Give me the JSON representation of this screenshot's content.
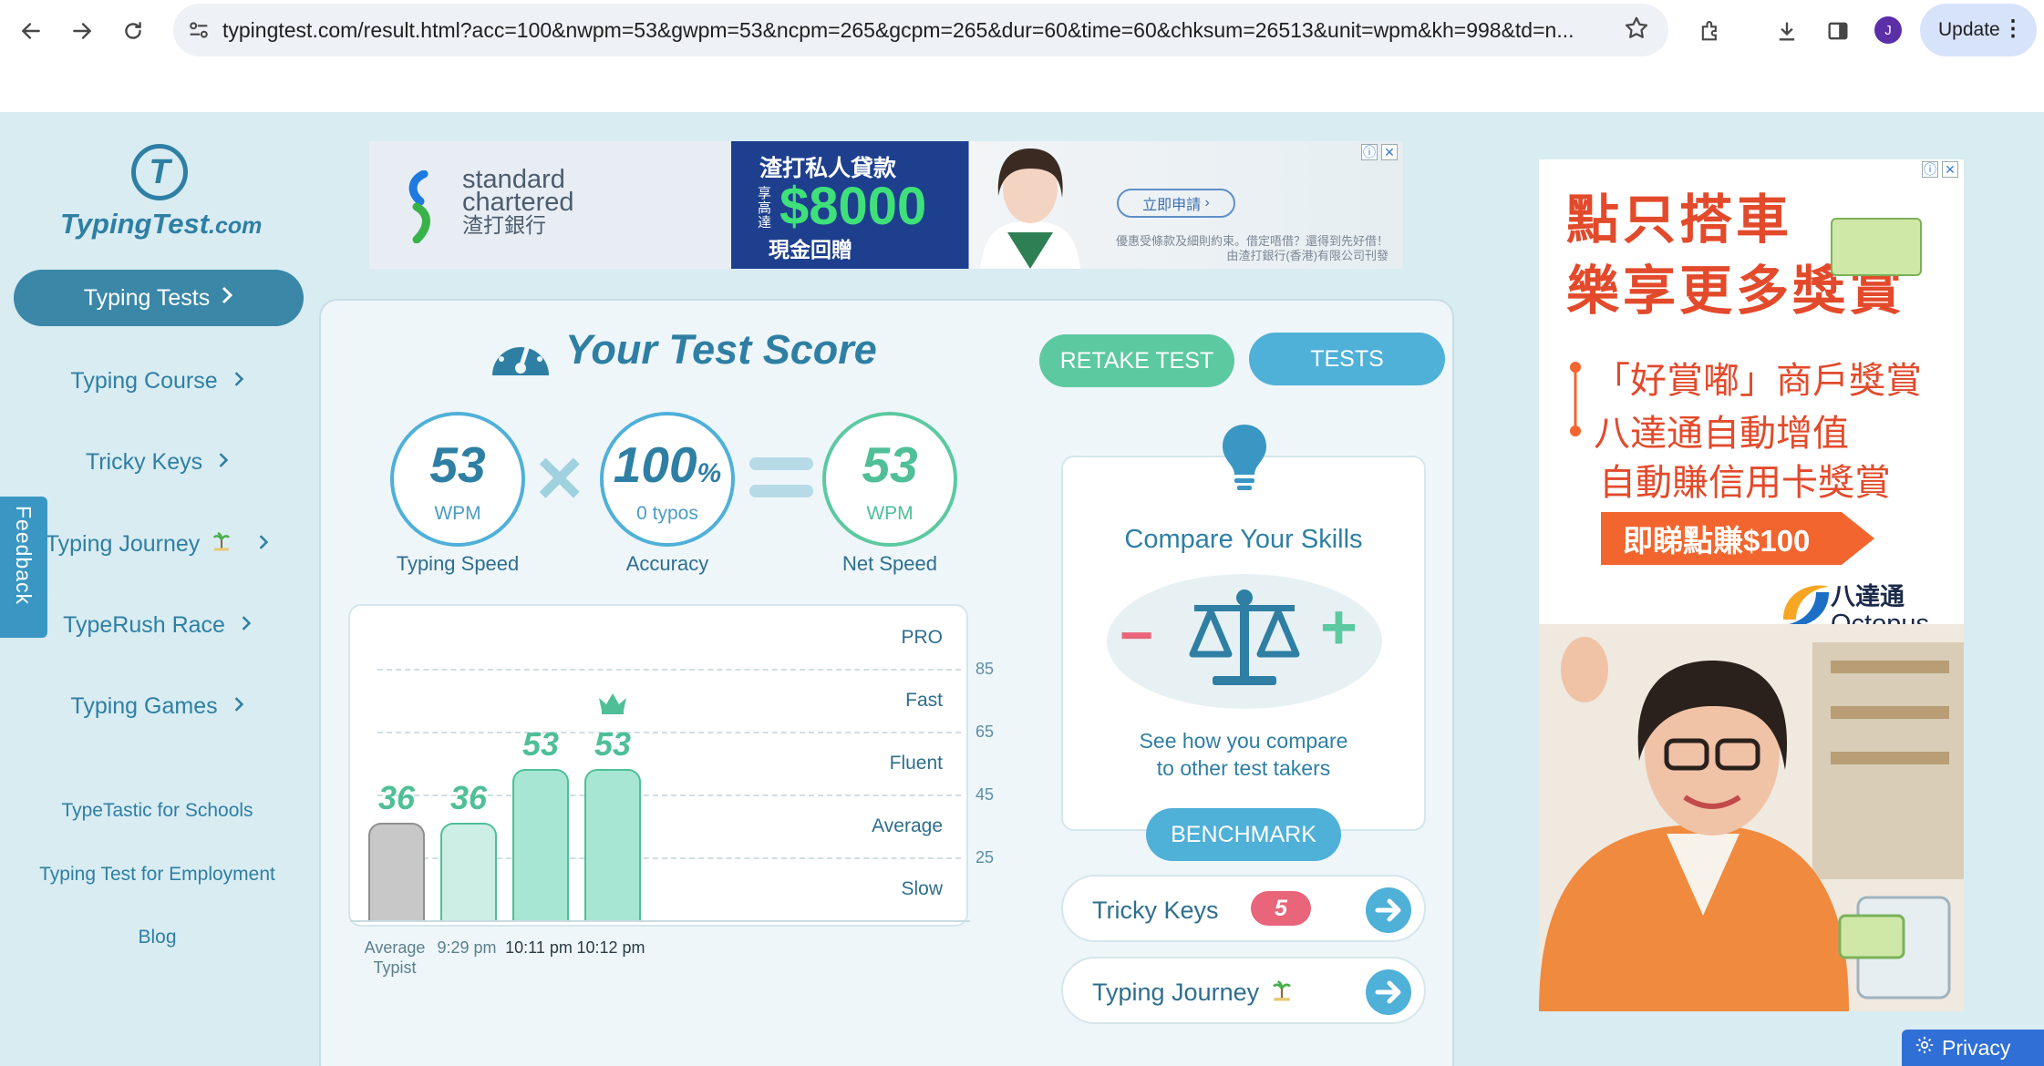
{
  "browser": {
    "url": "typingtest.com/result.html?acc=100&nwpm=53&gwpm=53&ncpm=265&gcpm=265&dur=60&time=60&chksum=26513&unit=wpm&kh=998&td=n...",
    "update_label": "Update",
    "profile_initial": "J"
  },
  "logo": {
    "mark": "T",
    "name": "TypingTest",
    "tld": ".com"
  },
  "sidebar": {
    "primary": "Typing Tests",
    "links": [
      "Typing Course",
      "Tricky Keys",
      "Typing Journey",
      "TypeRush Race",
      "Typing Games"
    ],
    "small_links": [
      "TypeTastic for Schools",
      "Typing Test for Employment",
      "Blog"
    ],
    "feedback": "Feedback"
  },
  "top_ad": {
    "brand_en_1": "standard",
    "brand_en_2": "chartered",
    "brand_zh": "渣打銀行",
    "headline": "渣打私人貸款",
    "side_text": "享高達",
    "amount": "$8000",
    "cash": "現金回贈",
    "apply": "立即申請",
    "fine_print": "優惠受條款及細則約束。借定唔借？還得到先好借！由渣打銀行(香港)有限公司刊發"
  },
  "score": {
    "title": "Your Test Score",
    "retake": "RETAKE TEST",
    "tests": "TESTS",
    "speed": {
      "value": "53",
      "unit": "WPM",
      "label": "Typing Speed"
    },
    "accuracy": {
      "value": "100",
      "pct": "%",
      "unit": "0 typos",
      "label": "Accuracy"
    },
    "net": {
      "value": "53",
      "unit": "WPM",
      "label": "Net Speed"
    },
    "times_sign": "×"
  },
  "chart_data": {
    "type": "bar",
    "categories": [
      "Average Typist",
      "9:29 pm",
      "10:11 pm",
      "10:12 pm"
    ],
    "values": [
      36,
      36,
      53,
      53
    ],
    "value_labels": [
      "36",
      "36",
      "53",
      "53"
    ],
    "ylim": [
      5,
      105
    ],
    "ticks": [
      85,
      65,
      45,
      25
    ],
    "tick_labels": [
      "85",
      "65",
      "45",
      "25"
    ],
    "tiers": [
      "PRO",
      "Fast",
      "Fluent",
      "Average",
      "Slow"
    ],
    "best_index": 3,
    "colors": {
      "average": "#c8c8c8",
      "recent": "#cdeee4",
      "highlight": "#a6e6d2"
    }
  },
  "compare": {
    "title": "Compare Your Skills",
    "line1": "See how you compare",
    "line2": "to other test takers",
    "button": "BENCHMARK",
    "minus": "−",
    "plus": "+"
  },
  "shortcuts": [
    {
      "label": "Tricky Keys",
      "badge": "5"
    },
    {
      "label": "Typing Journey"
    }
  ],
  "right_ad": {
    "head_1": "點只搭車",
    "head_2": "樂享更多獎賞",
    "line_1": "「好賞嘟」商戶獎賞",
    "line_2": "八達通自動增值",
    "line_3": "自動賺信用卡獎賞",
    "cta": "即睇點賺$100",
    "brand_zh": "八達通",
    "brand_en": "Octopus"
  },
  "privacy": "Privacy",
  "colors": {
    "primary": "#2e7fa3",
    "accent_green": "#5cc9a0",
    "accent_blue": "#4fb0d8"
  }
}
